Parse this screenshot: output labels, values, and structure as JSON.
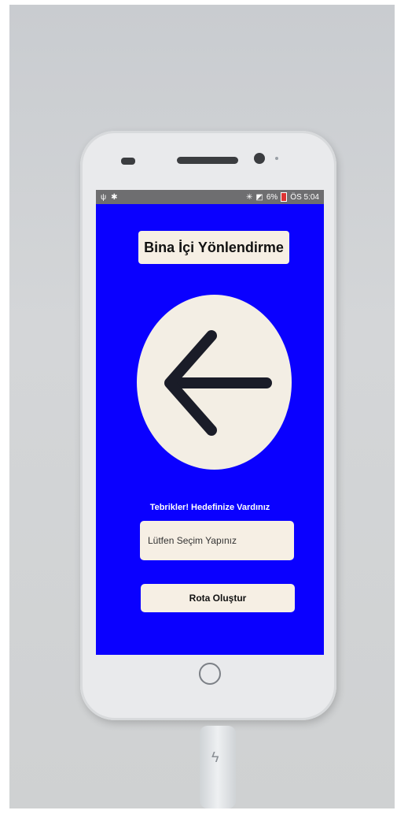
{
  "statusbar": {
    "left_icons": [
      "usb-icon",
      "android-icon"
    ],
    "battery": "6%",
    "time": "ÖS 5:04"
  },
  "app": {
    "title": "Bina İçi Yönlendirme",
    "direction_icon": "arrow-left-icon",
    "congrats_message": "Tebrikler! Hedefinize Vardınız",
    "select_placeholder": "Lütfen Seçim Yapınız",
    "route_button": "Rota Oluştur"
  },
  "colors": {
    "screen_bg": "#0a00ff",
    "panel_bg": "#f6efe4",
    "arrow": "#1a1c28"
  }
}
